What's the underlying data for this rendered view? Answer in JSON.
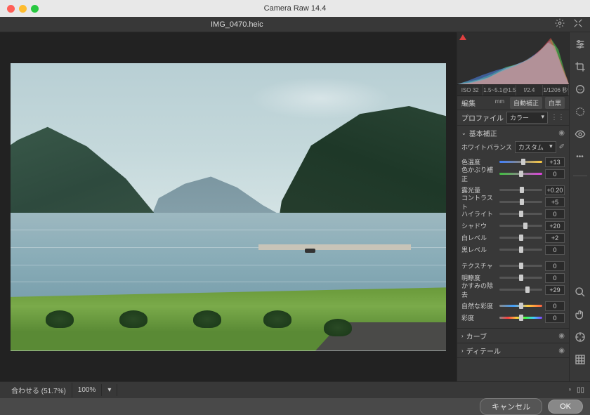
{
  "app_title": "Camera Raw 14.4",
  "filename": "IMG_0470.heic",
  "meta": {
    "iso": "ISO 32",
    "focal": "1.5~5.1@1.5 mm",
    "aperture": "f/2.4",
    "shutter": "1/1206 秒"
  },
  "edit": {
    "label": "編集",
    "auto": "自動補正",
    "bw": "白黒"
  },
  "profile": {
    "label": "プロファイル",
    "value": "カラー"
  },
  "basic": {
    "title": "基本補正",
    "wb_label": "ホワイトバランス",
    "wb_value": "カスタム",
    "sliders": [
      {
        "class": "temp",
        "label": "色温度",
        "value": "+13",
        "pos": 56
      },
      {
        "class": "tint",
        "label": "色かぶり補正",
        "value": "0",
        "pos": 50
      }
    ],
    "sliders2": [
      {
        "label": "露光量",
        "value": "+0.20",
        "pos": 52
      },
      {
        "label": "コントラスト",
        "value": "+5",
        "pos": 53
      },
      {
        "label": "ハイライト",
        "value": "0",
        "pos": 50
      },
      {
        "label": "シャドウ",
        "value": "+20",
        "pos": 60
      },
      {
        "label": "白レベル",
        "value": "+2",
        "pos": 51
      },
      {
        "label": "黒レベル",
        "value": "0",
        "pos": 50
      }
    ],
    "sliders3": [
      {
        "label": "テクスチャ",
        "value": "0",
        "pos": 50
      },
      {
        "label": "明瞭度",
        "value": "0",
        "pos": 50
      },
      {
        "label": "かすみの除去",
        "value": "+29",
        "pos": 65
      }
    ],
    "sliders4": [
      {
        "class": "vib",
        "label": "自然な彩度",
        "value": "0",
        "pos": 50
      },
      {
        "class": "sat",
        "label": "彩度",
        "value": "0",
        "pos": 50
      }
    ]
  },
  "sections": [
    {
      "title": "カーブ"
    },
    {
      "title": "ディテール"
    }
  ],
  "zoom": {
    "fit": "合わせる (51.7%)",
    "z100": "100%"
  },
  "footer": {
    "cancel": "キャンセル",
    "ok": "OK"
  }
}
